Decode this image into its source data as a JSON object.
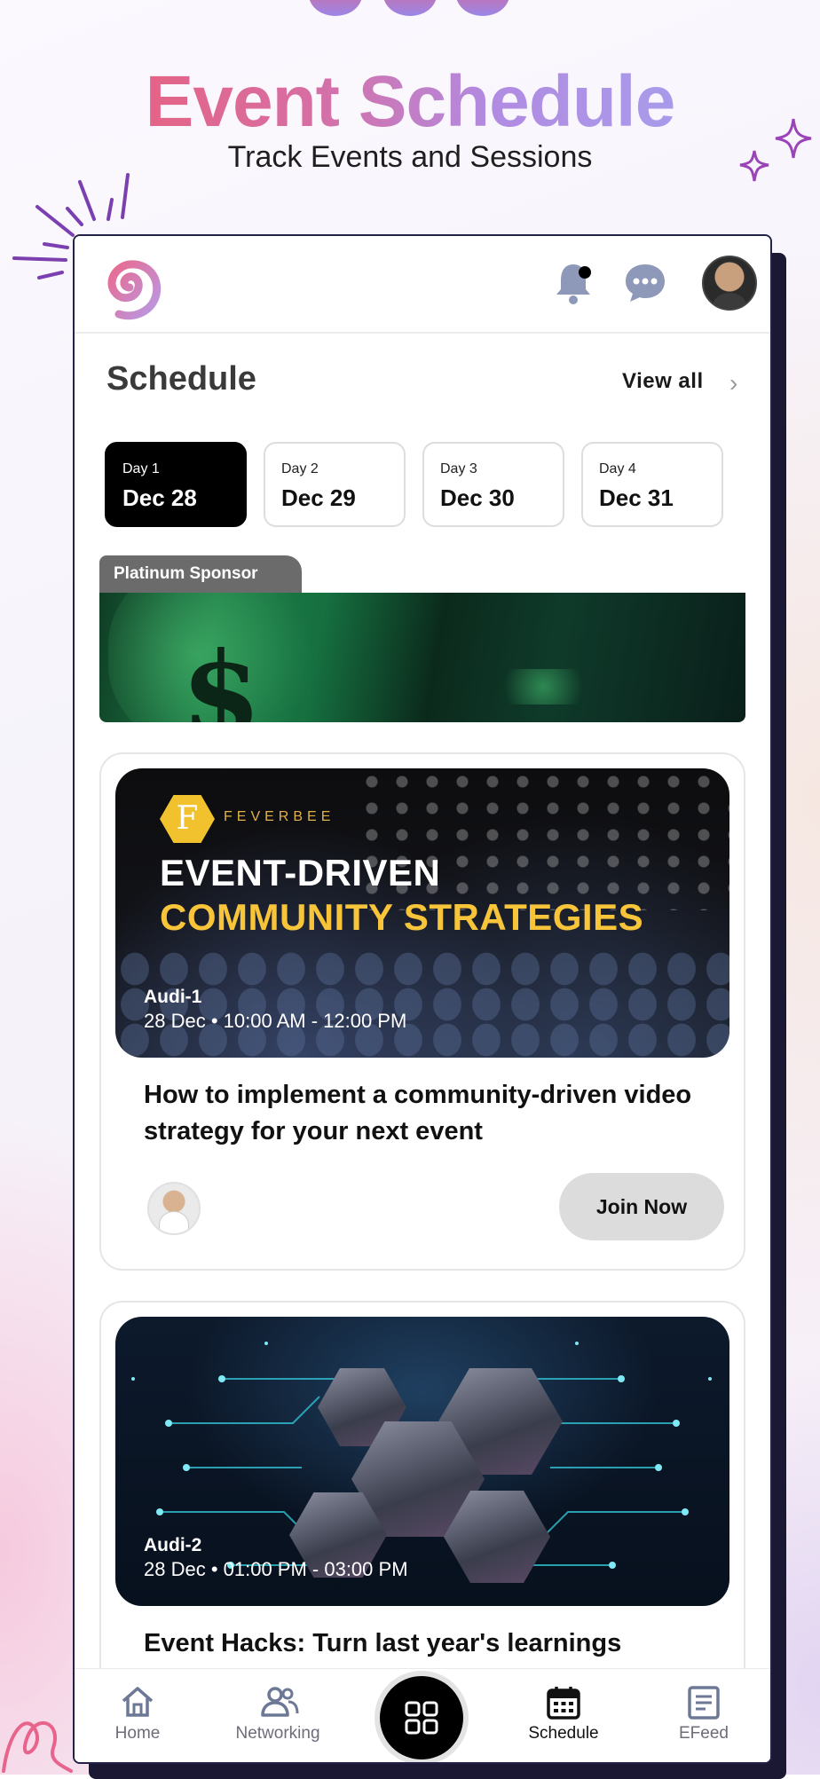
{
  "hero": {
    "title": "Event Schedule",
    "subtitle": "Track Events and Sessions"
  },
  "header": {
    "icons": [
      "spiral-logo",
      "bell-icon",
      "chat-bubble-icon",
      "user-avatar"
    ],
    "notification_dot": true
  },
  "schedule": {
    "title": "Schedule",
    "view_all": "View all",
    "days": [
      {
        "day": "Day 1",
        "date": "Dec 28",
        "active": true
      },
      {
        "day": "Day 2",
        "date": "Dec 29",
        "active": false
      },
      {
        "day": "Day 3",
        "date": "Dec 30",
        "active": false
      },
      {
        "day": "Day 4",
        "date": "Dec 31",
        "active": false
      }
    ]
  },
  "sponsor": {
    "tag": "Platinum Sponsor",
    "banner_colors": [
      "#1d7a45",
      "#0b2a1c"
    ]
  },
  "sessions": [
    {
      "brand": "FEVERBEE",
      "brand_letter": "F",
      "image_title_line1": "EVENT-DRIVEN",
      "image_title_line2": "COMMUNITY STRATEGIES",
      "venue": "Audi-1",
      "time": "28 Dec • 10:00 AM - 12:00 PM",
      "title": "How to implement a community-driven video strategy for your next event",
      "cta": "Join Now"
    },
    {
      "venue": "Audi-2",
      "time": "28 Dec • 01:00 PM - 03:00 PM",
      "title": "Event Hacks: Turn last year's learnings"
    }
  ],
  "nav": {
    "items": [
      {
        "label": "Home",
        "icon": "home-icon"
      },
      {
        "label": "Networking",
        "icon": "people-icon"
      },
      {
        "label": "",
        "icon": "grid-icon"
      },
      {
        "label": "Schedule",
        "icon": "calendar-icon",
        "active": true
      },
      {
        "label": "EFeed",
        "icon": "feed-icon"
      }
    ]
  },
  "colors": {
    "title_gradient": [
      "#ef5b6d",
      "#d76ea3",
      "#b18be2",
      "#a1a8f0"
    ],
    "accent_yellow": "#f7c43a",
    "active_tab": "#000000"
  }
}
